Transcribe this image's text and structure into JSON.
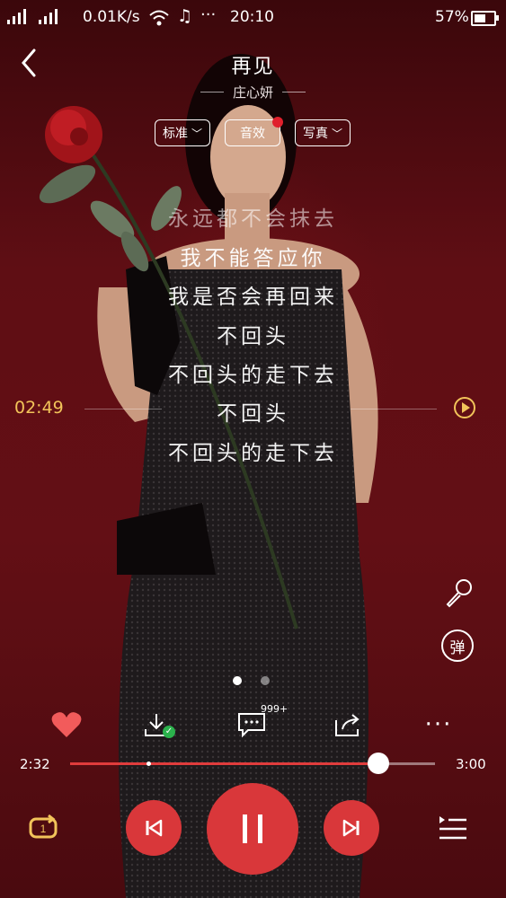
{
  "status_bar": {
    "net_speed": "0.01K/s",
    "time": "20:10",
    "battery": "57%"
  },
  "song": {
    "title": "再见",
    "artist": "庄心妍"
  },
  "tabs": [
    {
      "label": "标准"
    },
    {
      "label": "音效"
    },
    {
      "label": "写真"
    }
  ],
  "lyrics": [
    "永远都不会抹去",
    "我不能答应你",
    "我是否会再回来",
    "不回头",
    "不回头的走下去",
    "不回头",
    "不回头的走下去"
  ],
  "lyric_seek_time": "02:49",
  "side": {
    "danmu_label": "弹"
  },
  "comments_badge": "999+",
  "progress": {
    "current": "2:32",
    "total": "3:00",
    "played_fraction": 0.8444,
    "buffered_fraction": 0.21
  },
  "colors": {
    "accent_red": "#d9373a",
    "lyric_time": "#f2c45a",
    "like_heart": "#f25b5b"
  },
  "icons": {
    "back": "chevron-left-icon",
    "like": "heart-icon",
    "download": "download-icon",
    "comments": "comment-icon",
    "share": "share-icon",
    "more": "more-icon",
    "mic": "microphone-icon",
    "loop": "loop-one-icon",
    "prev": "previous-icon",
    "pause": "pause-icon",
    "next": "next-icon",
    "playlist": "playlist-icon"
  }
}
